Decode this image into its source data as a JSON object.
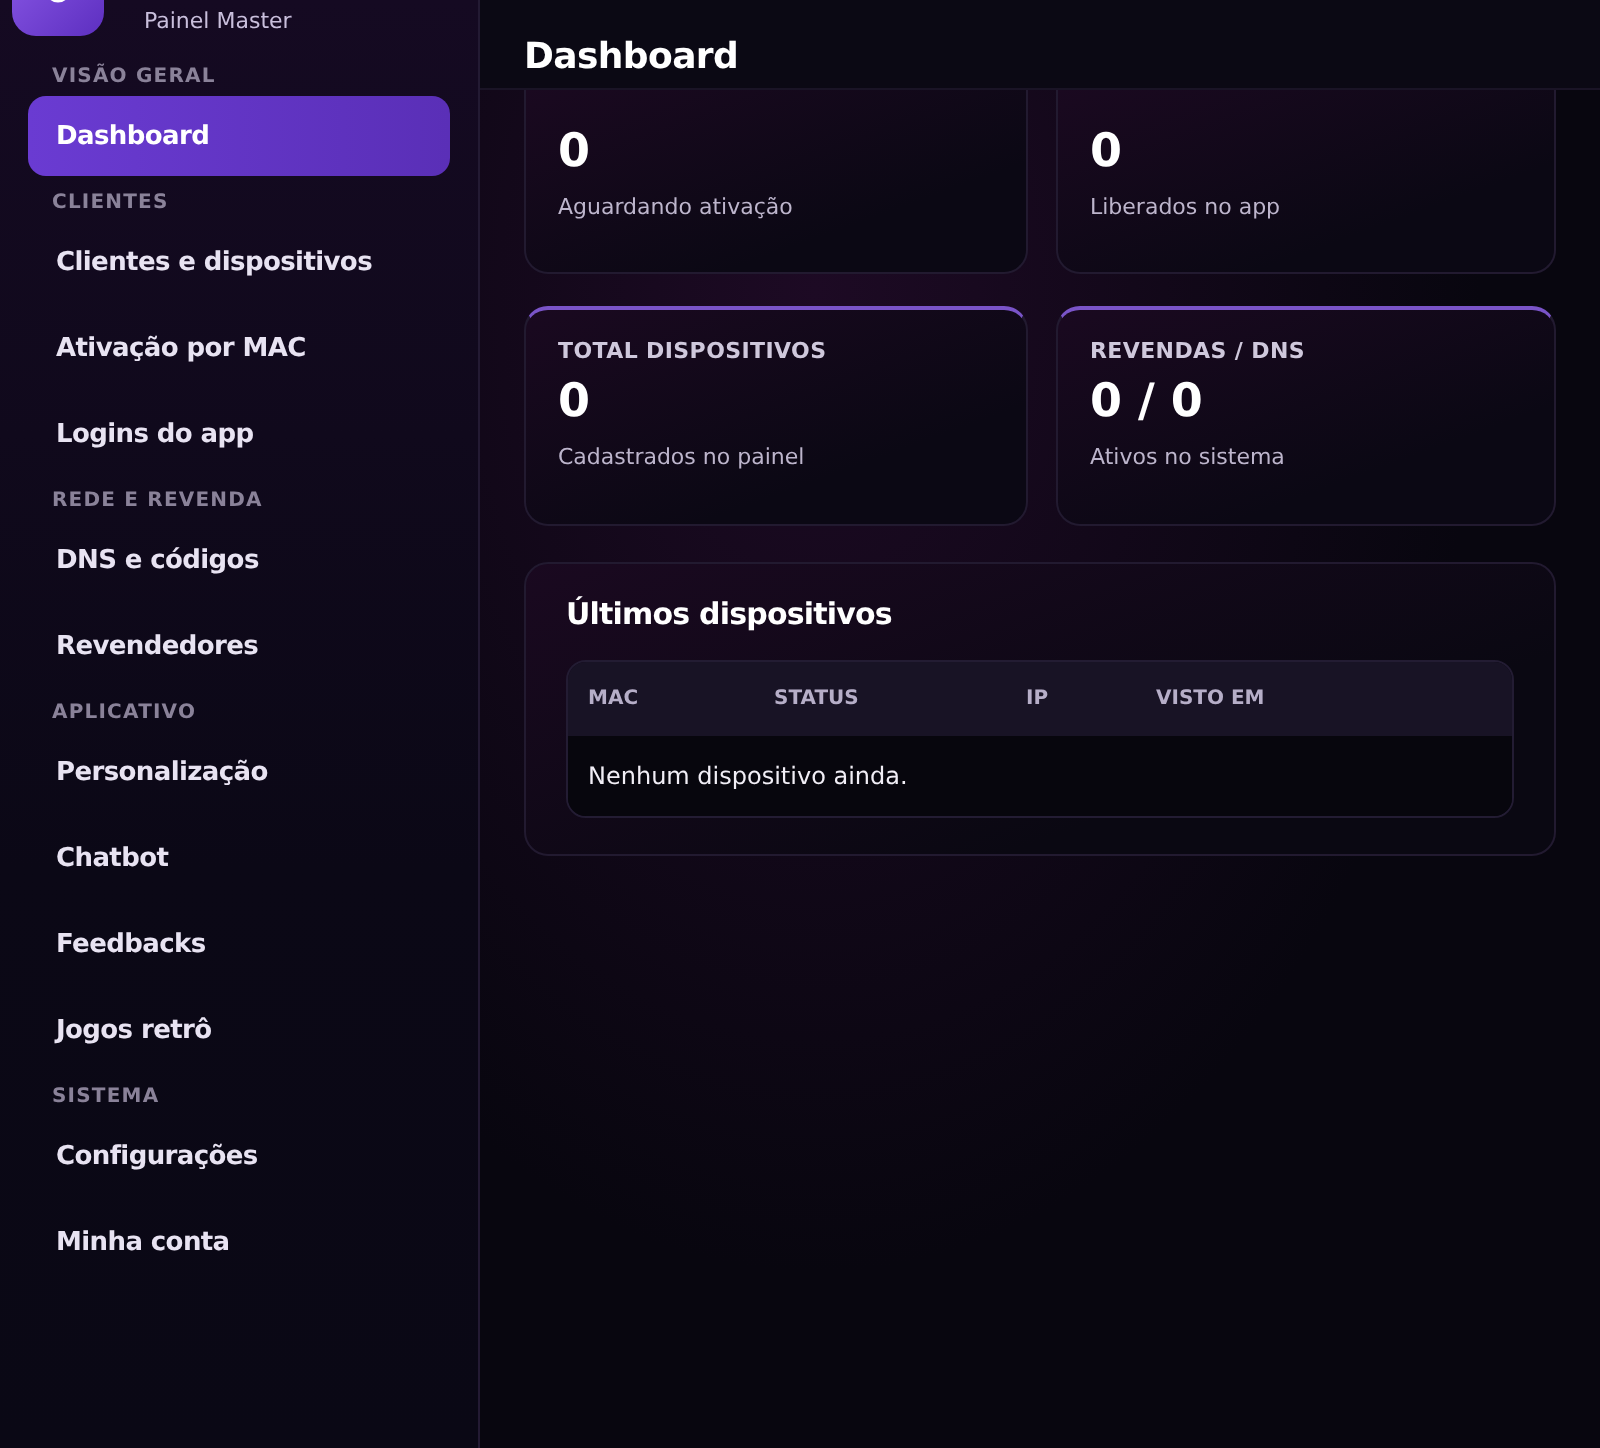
{
  "sidebar": {
    "brand_subtitle": "Painel Master",
    "sections": [
      {
        "title": "VISÃO GERAL",
        "items": [
          {
            "label": "Dashboard",
            "selected": true
          }
        ]
      },
      {
        "title": "CLIENTES",
        "items": [
          {
            "label": "Clientes e dispositivos",
            "selected": false
          },
          {
            "label": "Ativação por MAC",
            "selected": false
          },
          {
            "label": "Logins do app",
            "selected": false
          }
        ]
      },
      {
        "title": "REDE E REVENDA",
        "items": [
          {
            "label": "DNS e códigos",
            "selected": false
          },
          {
            "label": "Revendedores",
            "selected": false
          }
        ]
      },
      {
        "title": "APLICATIVO",
        "items": [
          {
            "label": "Personalização",
            "selected": false
          },
          {
            "label": "Chatbot",
            "selected": false
          },
          {
            "label": "Feedbacks",
            "selected": false
          },
          {
            "label": "Jogos retrô",
            "selected": false
          }
        ]
      },
      {
        "title": "SISTEMA",
        "items": [
          {
            "label": "Configurações",
            "selected": false
          },
          {
            "label": "Minha conta",
            "selected": false
          }
        ]
      }
    ]
  },
  "header": {
    "title": "Dashboard"
  },
  "stats": [
    {
      "value": "0",
      "caption": "Aguardando ativação"
    },
    {
      "value": "0",
      "caption": "Liberados no app"
    },
    {
      "label": "TOTAL DISPOSITIVOS",
      "value": "0",
      "caption": "Cadastrados no painel"
    },
    {
      "label": "REVENDAS / DNS",
      "value": "0 / 0",
      "caption": "Ativos no sistema"
    }
  ],
  "latest_devices": {
    "title": "Últimos dispositivos",
    "columns": [
      "MAC",
      "STATUS",
      "IP",
      "VISTO EM"
    ],
    "empty_message": "Nenhum dispositivo ainda."
  }
}
